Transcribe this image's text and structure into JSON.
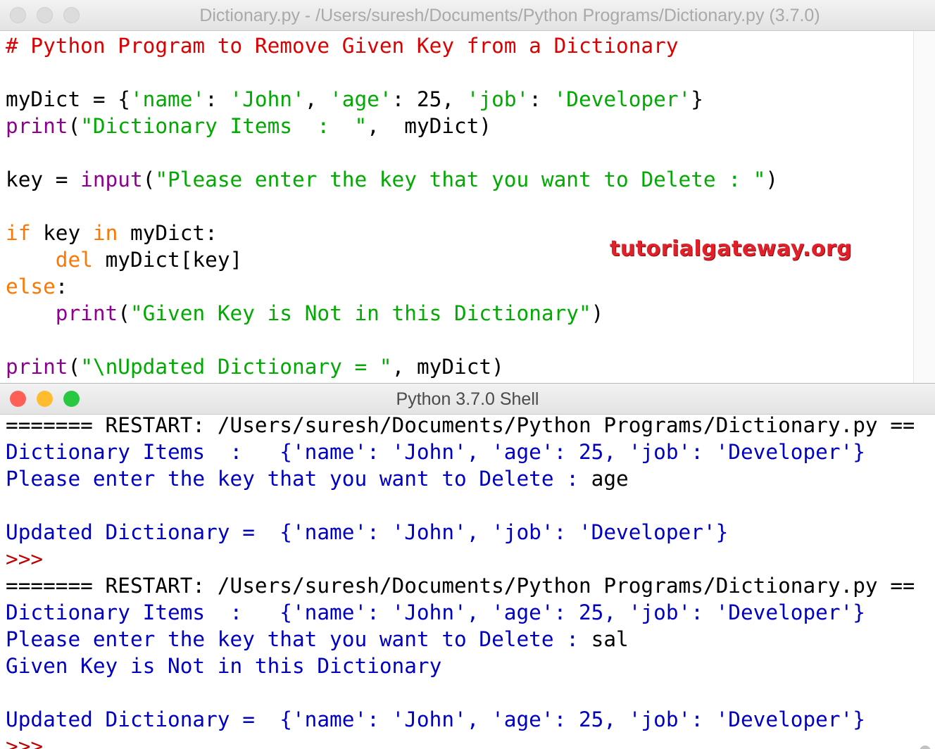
{
  "editor": {
    "title": "Dictionary.py - /Users/suresh/Documents/Python Programs/Dictionary.py (3.7.0)",
    "watermark": "tutorialgateway.org",
    "lines": [
      [
        {
          "t": "# Python Program to Remove Given Key from a Dictionary",
          "c": "cmt"
        }
      ],
      [],
      [
        {
          "t": "myDict = {",
          "c": "pl"
        },
        {
          "t": "'name'",
          "c": "str"
        },
        {
          "t": ": ",
          "c": "pl"
        },
        {
          "t": "'John'",
          "c": "str"
        },
        {
          "t": ", ",
          "c": "pl"
        },
        {
          "t": "'age'",
          "c": "str"
        },
        {
          "t": ": 25, ",
          "c": "pl"
        },
        {
          "t": "'job'",
          "c": "str"
        },
        {
          "t": ": ",
          "c": "pl"
        },
        {
          "t": "'Developer'",
          "c": "str"
        },
        {
          "t": "}",
          "c": "pl"
        }
      ],
      [
        {
          "t": "print",
          "c": "bi"
        },
        {
          "t": "(",
          "c": "pl"
        },
        {
          "t": "\"Dictionary Items  :  \"",
          "c": "str"
        },
        {
          "t": ",  myDict)",
          "c": "pl"
        }
      ],
      [],
      [
        {
          "t": "key = ",
          "c": "pl"
        },
        {
          "t": "input",
          "c": "bi"
        },
        {
          "t": "(",
          "c": "pl"
        },
        {
          "t": "\"Please enter the key that you want to Delete : \"",
          "c": "str"
        },
        {
          "t": ")",
          "c": "pl"
        }
      ],
      [],
      [
        {
          "t": "if",
          "c": "kw"
        },
        {
          "t": " key ",
          "c": "pl"
        },
        {
          "t": "in",
          "c": "kw"
        },
        {
          "t": " myDict:",
          "c": "pl"
        }
      ],
      [
        {
          "t": "    ",
          "c": "pl"
        },
        {
          "t": "del",
          "c": "kw"
        },
        {
          "t": " myDict[key]",
          "c": "pl"
        }
      ],
      [
        {
          "t": "else",
          "c": "kw"
        },
        {
          "t": ":",
          "c": "pl"
        }
      ],
      [
        {
          "t": "    ",
          "c": "pl"
        },
        {
          "t": "print",
          "c": "bi"
        },
        {
          "t": "(",
          "c": "pl"
        },
        {
          "t": "\"Given Key is Not in this Dictionary\"",
          "c": "str"
        },
        {
          "t": ")",
          "c": "pl"
        }
      ],
      [],
      [
        {
          "t": "print",
          "c": "bi"
        },
        {
          "t": "(",
          "c": "pl"
        },
        {
          "t": "\"\\nUpdated Dictionary = \"",
          "c": "str"
        },
        {
          "t": ", myDict)",
          "c": "pl"
        }
      ]
    ]
  },
  "shell": {
    "title": "Python 3.7.0 Shell",
    "lines": [
      [
        {
          "t": "======= RESTART: /Users/suresh/Documents/Python Programs/Dictionary.py =======",
          "c": "pl"
        }
      ],
      [
        {
          "t": "Dictionary Items  :   {'name': 'John', 'age': 25, 'job': 'Developer'}",
          "c": "out"
        }
      ],
      [
        {
          "t": "Please enter the key that you want to Delete : ",
          "c": "out"
        },
        {
          "t": "age",
          "c": "pl"
        }
      ],
      [],
      [
        {
          "t": "Updated Dictionary =  {'name': 'John', 'job': 'Developer'}",
          "c": "out"
        }
      ],
      [
        {
          "t": ">>> ",
          "c": "prompt"
        }
      ],
      [
        {
          "t": "======= RESTART: /Users/suresh/Documents/Python Programs/Dictionary.py =======",
          "c": "pl"
        }
      ],
      [
        {
          "t": "Dictionary Items  :   {'name': 'John', 'age': 25, 'job': 'Developer'}",
          "c": "out"
        }
      ],
      [
        {
          "t": "Please enter the key that you want to Delete : ",
          "c": "out"
        },
        {
          "t": "sal",
          "c": "pl"
        }
      ],
      [
        {
          "t": "Given Key is Not in this Dictionary",
          "c": "out"
        }
      ],
      [],
      [
        {
          "t": "Updated Dictionary =  {'name': 'John', 'age': 25, 'job': 'Developer'}",
          "c": "out"
        }
      ],
      [
        {
          "t": ">>> ",
          "c": "prompt"
        }
      ]
    ]
  },
  "colors": {
    "comment": "#dd0000",
    "string": "#00aa00",
    "keyword": "#ff7700",
    "builtin": "#900090",
    "output": "#0000c0",
    "prompt": "#c00000",
    "close": "#fe5f57",
    "minimize": "#febc2e",
    "zoom": "#28c840"
  }
}
